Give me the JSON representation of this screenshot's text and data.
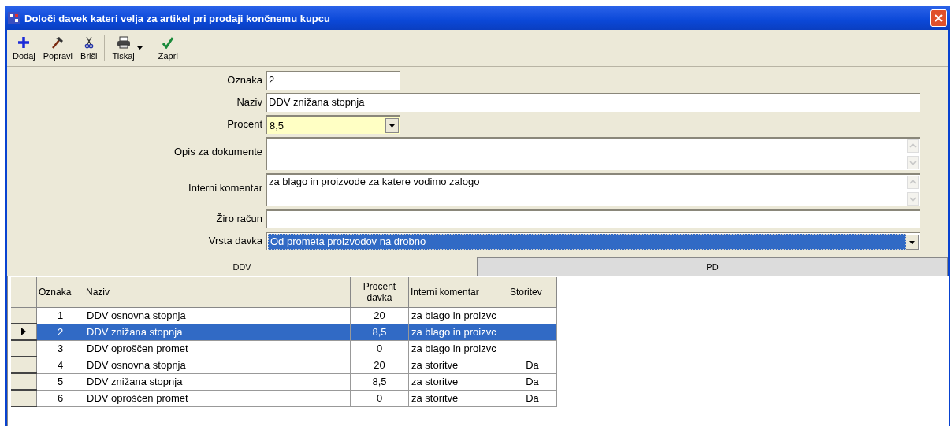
{
  "window": {
    "title": "Določi davek kateri velja za artikel pri prodaji končnemu kupcu"
  },
  "toolbar": [
    {
      "label": "Dodaj",
      "kind": "plus"
    },
    {
      "label": "Popravi",
      "kind": "hammer"
    },
    {
      "label": "Briši",
      "kind": "scissors"
    },
    {
      "label": "Tiskaj",
      "kind": "printer",
      "dropdown": true
    },
    {
      "label": "Zapri",
      "kind": "check"
    }
  ],
  "form": [
    {
      "label": "Oznaka",
      "kind": "short",
      "value": "2"
    },
    {
      "label": "Naziv",
      "kind": "text",
      "value": "DDV znižana stopnja"
    },
    {
      "label": "Procent",
      "kind": "combo-short",
      "value": "8,5"
    },
    {
      "label": "Opis za dokumente",
      "kind": "memo"
    },
    {
      "label": "Interni komentar",
      "kind": "memo",
      "value": "za blago in proizvode za katere vodimo zalogo"
    },
    {
      "label": "Žiro račun",
      "kind": "text"
    },
    {
      "label": "Vrsta davka",
      "kind": "combo",
      "value": "Od prometa proizvodov na drobno"
    }
  ],
  "tabs": [
    {
      "label": "DDV",
      "selected": true
    },
    {
      "label": "PD",
      "selected": false
    }
  ],
  "table": {
    "columns": [
      "Oznaka",
      "Naziv",
      "Procent davka",
      "Interni komentar",
      "Storitev"
    ],
    "rows": [
      {
        "cells": [
          "1",
          "DDV osnovna stopnja",
          "20",
          "za blago in proizvc",
          ""
        ],
        "selected": false
      },
      {
        "cells": [
          "2",
          "DDV znižana stopnja",
          "8,5",
          "za blago in proizvc",
          ""
        ],
        "selected": true
      },
      {
        "cells": [
          "3",
          "DDV oproščen promet",
          "0",
          "za blago in proizvc",
          ""
        ],
        "selected": false
      },
      {
        "cells": [
          "4",
          "DDV osnovna stopnja",
          "20",
          "za storitve",
          "Da"
        ],
        "selected": false
      },
      {
        "cells": [
          "5",
          "DDV znižana stopnja",
          "8,5",
          "za storitve",
          "Da"
        ],
        "selected": false
      },
      {
        "cells": [
          "6",
          "DDV oproščen promet",
          "0",
          "za storitve",
          "Da"
        ],
        "selected": false
      }
    ]
  }
}
